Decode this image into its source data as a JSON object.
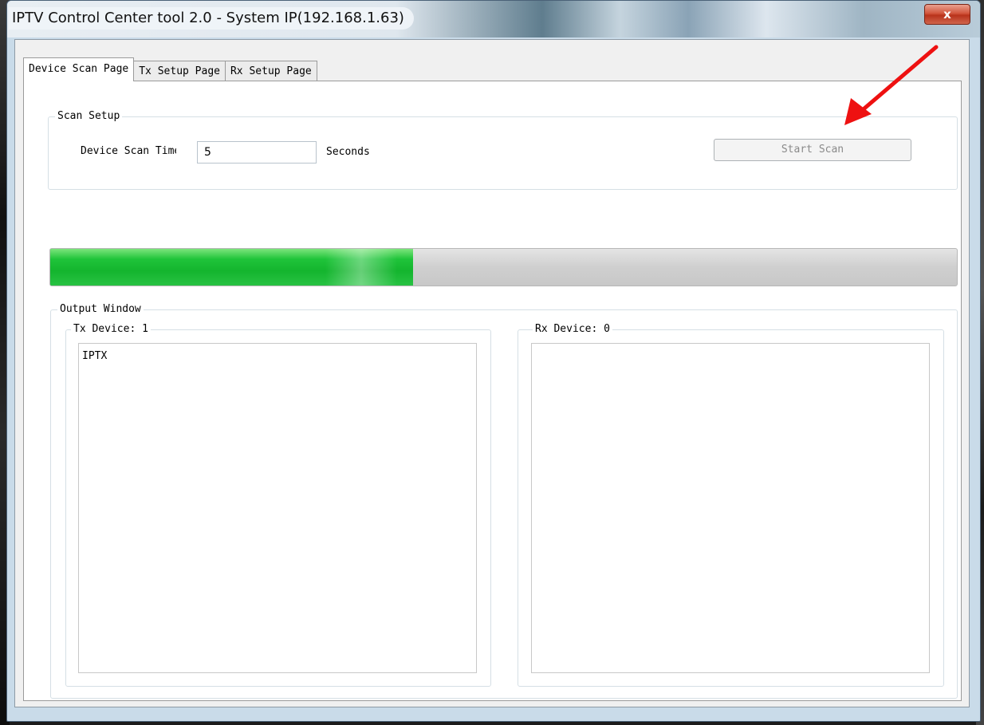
{
  "window": {
    "title": "IPTV Control Center tool 2.0 - System IP(192.168.1.63)",
    "close_label": "x"
  },
  "tabs": [
    {
      "label": "Device Scan Page",
      "active": true
    },
    {
      "label": "Tx Setup Page",
      "active": false
    },
    {
      "label": "Rx Setup Page",
      "active": false
    }
  ],
  "scan_setup": {
    "group_label": "Scan Setup",
    "time_label": "Device Scan Time:",
    "time_value": "5",
    "unit_label": "Seconds",
    "start_button_label": "Start Scan"
  },
  "progress": {
    "percent": 40
  },
  "output": {
    "group_label": "Output Window",
    "tx_label": "Tx Device: 1",
    "tx_items": [
      "IPTX"
    ],
    "rx_label": "Rx Device: 0",
    "rx_items": []
  },
  "colors": {
    "progress_fill": "#1fc43a",
    "annotation_arrow": "#ee1111"
  }
}
